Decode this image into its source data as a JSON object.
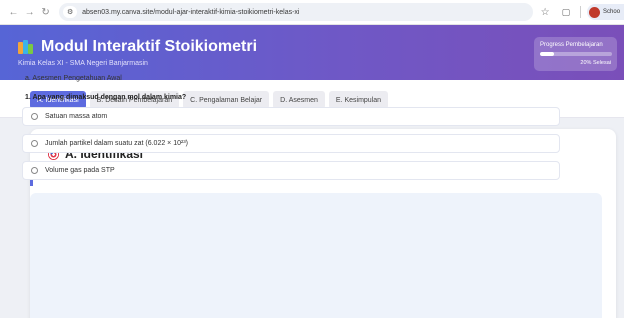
{
  "browser": {
    "url": "absen03.my.canva.site/modul-ajar-interaktif-kimia-stoikiometri-kelas-xi",
    "profile_label": "Schoo"
  },
  "header": {
    "title": "Modul Interaktif Stoikiometri",
    "subtitle": "Kimia Kelas XI - SMA Negeri Banjarmasin",
    "progress_label": "Progress Pembelajaran",
    "progress_text": "20% Selesai",
    "progress_value": 0.2
  },
  "tabs": [
    {
      "label": "A. Identifikasi",
      "active": true
    },
    {
      "label": "B. Desain Pembelajaran",
      "active": false
    },
    {
      "label": "C. Pengalaman Belajar",
      "active": false
    },
    {
      "label": "D. Asesmen",
      "active": false
    },
    {
      "label": "E. Kesimpulan",
      "active": false
    }
  ],
  "section": {
    "title": "A. Identifikasi",
    "subsection": "1. Peserta Didik",
    "panel_heading": "a. Asesmen Pengetahuan Awal",
    "question": "1. Apa yang dimaksud dengan mol dalam kimia?",
    "options": [
      "Satuan massa atom",
      "Jumlah partikel dalam suatu zat (6.022 × 10²³)",
      "Volume gas pada STP"
    ]
  },
  "icons": {
    "header_icon": "books-icon",
    "section_icon": "target-icon"
  },
  "colors": {
    "header_gradient_start": "#5665d6",
    "header_gradient_end": "#7a4fb9",
    "accent": "#5d6bdf"
  }
}
